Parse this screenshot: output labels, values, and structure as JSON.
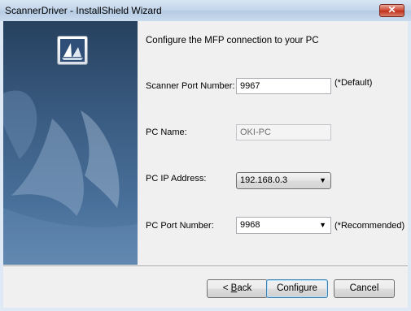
{
  "window": {
    "title": "ScannerDriver - InstallShield Wizard",
    "close_label": "close"
  },
  "header": {
    "heading": "Configure the MFP connection to your PC"
  },
  "form": {
    "scanner_port": {
      "label": "Scanner Port Number:",
      "value": "9967",
      "note": "(*Default)"
    },
    "pc_name": {
      "label": "PC Name:",
      "value": "OKI-PC"
    },
    "pc_ip": {
      "label": "PC IP Address:",
      "value": "192.168.0.3"
    },
    "pc_port": {
      "label": "PC Port Number:",
      "value": "9968",
      "note": "(*Recommended)"
    }
  },
  "buttons": {
    "back_prefix": "< ",
    "back_mnemonic": "B",
    "back_rest": "ack",
    "configure": "Configure",
    "cancel": "Cancel"
  },
  "icons": {
    "close": "close-icon",
    "logo": "installshield-logo-icon",
    "dropdown": "chevron-down-icon"
  },
  "colors": {
    "banner_top": "#27415f",
    "banner_bottom": "#5e85ad",
    "default_button_border": "#3c7fb1"
  }
}
